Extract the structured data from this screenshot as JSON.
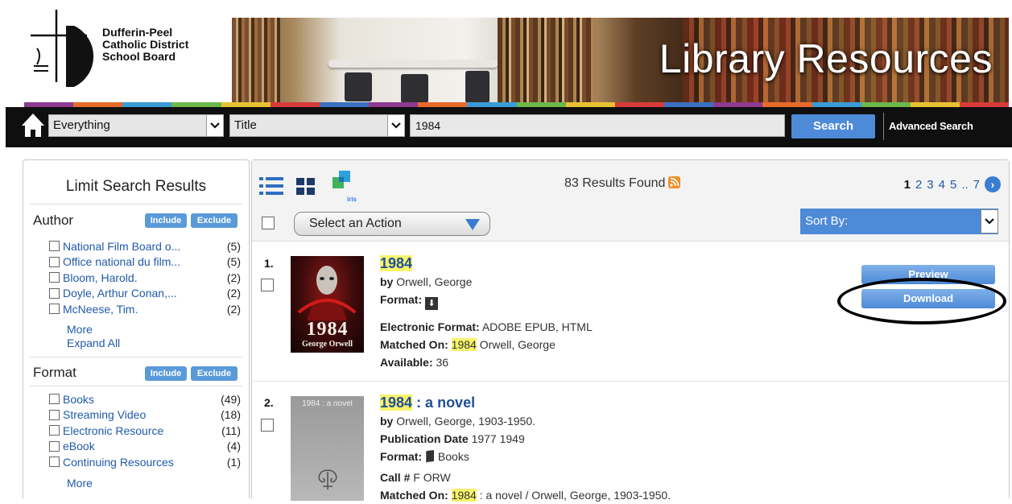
{
  "header": {
    "org_name_lines": [
      "Dufferin-Peel",
      "Catholic District",
      "School Board"
    ],
    "banner_title": "Library Resources",
    "stripe_colors": [
      "#8e3a8f",
      "#e86a2a",
      "#3a9bd6",
      "#6bb84a",
      "#e9c232",
      "#d83a3a",
      "#3a6fc2",
      "#8e3a8f",
      "#e86a2a",
      "#3a9bd6",
      "#6bb84a",
      "#e9c232",
      "#d83a3a",
      "#3a6fc2",
      "#8e3a8f",
      "#e86a2a",
      "#3a9bd6",
      "#6bb84a",
      "#e9c232",
      "#d83a3a"
    ]
  },
  "search": {
    "scope_value": "Everything",
    "field_value": "Title",
    "query_value": "1984",
    "search_label": "Search",
    "advanced_label": "Advanced Search"
  },
  "sidebar": {
    "title": "Limit Search Results",
    "include_label": "Include",
    "exclude_label": "Exclude",
    "author": {
      "heading": "Author",
      "items": [
        {
          "label": "National Film Board o...",
          "count": "(5)"
        },
        {
          "label": "Office national du film...",
          "count": "(5)"
        },
        {
          "label": "Bloom, Harold.",
          "count": "(2)"
        },
        {
          "label": "Doyle, Arthur Conan,...",
          "count": "(2)"
        },
        {
          "label": "McNeese, Tim.",
          "count": "(2)"
        }
      ],
      "more_label": "More",
      "expand_label": "Expand All"
    },
    "format": {
      "heading": "Format",
      "items": [
        {
          "label": "Books",
          "count": "(49)"
        },
        {
          "label": "Streaming Video",
          "count": "(18)"
        },
        {
          "label": "Electronic Resource",
          "count": "(11)"
        },
        {
          "label": "eBook",
          "count": "(4)"
        },
        {
          "label": "Continuing Resources",
          "count": "(1)"
        }
      ],
      "more_label": "More"
    }
  },
  "results": {
    "count_text": "83 Results Found",
    "iris_label": "iris",
    "pages": [
      "1",
      "2",
      "3",
      "4",
      "5",
      "..",
      "7"
    ],
    "current_page": "1",
    "action_label": "Select an Action",
    "sort_label": "Sort By:",
    "items": [
      {
        "number": "1.",
        "title": "1984",
        "by_label": "by",
        "author": "Orwell, George",
        "format_label": "Format:",
        "cover_title": "1984",
        "cover_author": "George Orwell",
        "electronic_format_label": "Electronic Format:",
        "electronic_format": "ADOBE EPUB, HTML",
        "matched_label": "Matched On:",
        "matched_hl": "1984",
        "matched_rest": "Orwell, George",
        "available_label": "Available:",
        "available": "36",
        "preview_label": "Preview",
        "download_label": "Download"
      },
      {
        "number": "2.",
        "title": "1984",
        "title_rest": ": a novel",
        "by_label": "by",
        "author": "Orwell, George, 1903-1950.",
        "cover_title": "1984 : a novel",
        "pub_label": "Publication Date",
        "pub_value": "1977 1949",
        "format_label": "Format:",
        "format_value": "Books",
        "call_label": "Call #",
        "call_value": "F ORW",
        "matched_label": "Matched On:",
        "matched_hl": "1984",
        "matched_rest": ": a novel / Orwell, George, 1903-1950."
      }
    ]
  }
}
